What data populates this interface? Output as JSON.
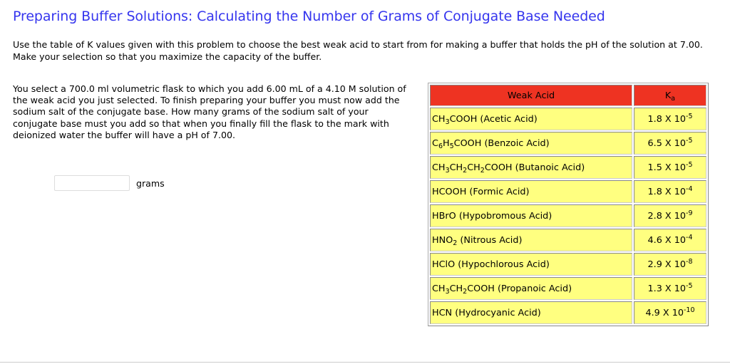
{
  "title": "Preparing Buffer Solutions: Calculating the Number of Grams of Conjugate Base Needed",
  "intro": "Use the table of K values given with this problem to choose the best weak acid to start from for making a buffer that holds the pH of the solution at 7.00. Make your selection so that you maximize the capacity of the buffer.",
  "problem": "You select a 700.0 ml volumetric flask to which you add 6.00 mL of a 4.10 M solution of the weak acid you just selected. To finish preparing your buffer you must now add the sodium salt of the conjugate base. How many grams of the sodium salt of your conjugate base must you add so that when you finally fill the flask to the mark with deionized water the buffer will have a pH of 7.00.",
  "answer": {
    "value": "",
    "placeholder": "",
    "unit": "grams"
  },
  "table": {
    "header_acid": "Weak Acid",
    "header_ka": "K",
    "header_ka_sub": "a",
    "rows": [
      {
        "formula": [
          "CH",
          "3",
          "COOH"
        ],
        "name": "(Acetic Acid)",
        "ka": "1.8 X 10",
        "exp": "-5"
      },
      {
        "formula": [
          "C",
          "6",
          "H",
          "5",
          "COOH"
        ],
        "name": "(Benzoic Acid)",
        "ka": "6.5 X 10",
        "exp": "-5"
      },
      {
        "formula": [
          "CH",
          "3",
          "CH",
          "2",
          "CH",
          "2",
          "COOH"
        ],
        "name": "(Butanoic Acid)",
        "ka": "1.5 X 10",
        "exp": "-5"
      },
      {
        "formula": [
          "HCOOH"
        ],
        "name": "(Formic Acid)",
        "ka": "1.8 X 10",
        "exp": "-4"
      },
      {
        "formula": [
          "HBrO"
        ],
        "name": "(Hypobromous Acid)",
        "ka": "2.8 X 10",
        "exp": "-9"
      },
      {
        "formula": [
          "HNO",
          "2"
        ],
        "name": "(Nitrous Acid)",
        "ka": "4.6 X 10",
        "exp": "-4"
      },
      {
        "formula": [
          "HClO"
        ],
        "name": "(Hypochlorous Acid)",
        "ka": "2.9 X 10",
        "exp": "-8"
      },
      {
        "formula": [
          "CH",
          "3",
          "CH",
          "2",
          "COOH"
        ],
        "name": "(Propanoic Acid)",
        "ka": "1.3 X 10",
        "exp": "-5"
      },
      {
        "formula": [
          "HCN"
        ],
        "name": "(Hydrocyanic Acid)",
        "ka": "4.9 X 10",
        "exp": "-10"
      }
    ]
  },
  "colors": {
    "title": "#3535ee",
    "header": "#ee3322",
    "cell": "#ffff80"
  }
}
